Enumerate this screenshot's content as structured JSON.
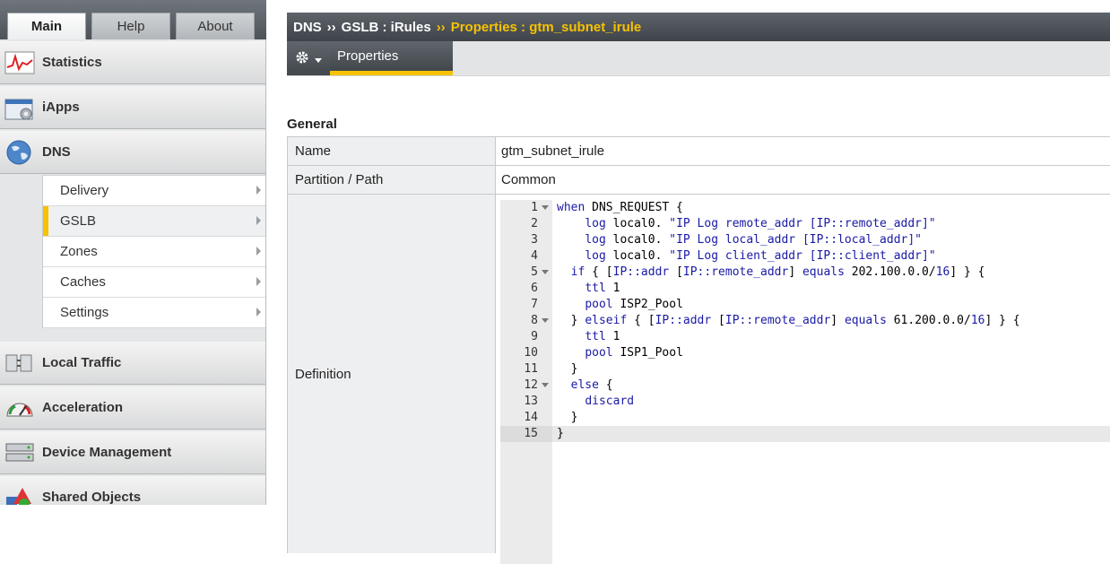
{
  "top_tabs": [
    {
      "label": "Main",
      "active": true
    },
    {
      "label": "Help",
      "active": false
    },
    {
      "label": "About",
      "active": false
    }
  ],
  "nav": {
    "sections": [
      {
        "label": "Statistics",
        "icon": "statistics-chart-icon"
      },
      {
        "label": "iApps",
        "icon": "iapps-gear-icon"
      },
      {
        "label": "DNS",
        "icon": "globe-icon"
      },
      {
        "label": "Local Traffic",
        "icon": "local-traffic-icon"
      },
      {
        "label": "Acceleration",
        "icon": "speedometer-icon"
      },
      {
        "label": "Device Management",
        "icon": "server-icon"
      },
      {
        "label": "Shared Objects",
        "icon": "shapes-icon"
      }
    ],
    "dns_items": [
      {
        "label": "Delivery"
      },
      {
        "label": "GSLB",
        "selected": true
      },
      {
        "label": "Zones"
      },
      {
        "label": "Caches"
      },
      {
        "label": "Settings"
      }
    ]
  },
  "breadcrumb": {
    "part1": "DNS",
    "sep": "››",
    "part2": "GSLB : iRules",
    "current": "Properties : gtm_subnet_irule"
  },
  "toolbar": {
    "gear_icon": "gear-icon",
    "tab_label": "Properties"
  },
  "section_title": "General",
  "properties": {
    "name_label": "Name",
    "name_value": "gtm_subnet_irule",
    "partition_label": "Partition / Path",
    "partition_value": "Common",
    "definition_label": "Definition"
  },
  "code": {
    "lines": [
      "when DNS_REQUEST {",
      "    log local0. \"IP Log remote_addr [IP::remote_addr]\"",
      "    log local0. \"IP Log local_addr [IP::local_addr]\"",
      "    log local0. \"IP Log client_addr [IP::client_addr]\"",
      "  if { [IP::addr [IP::remote_addr] equals 202.100.0.0/16] } {",
      "    ttl 1",
      "    pool ISP2_Pool",
      "  } elseif { [IP::addr [IP::remote_addr] equals 61.200.0.0/16] } {",
      "    ttl 1",
      "    pool ISP1_Pool",
      "  }",
      "  else {",
      "    discard",
      "  }",
      "}"
    ],
    "fold_lines": [
      1,
      5,
      8,
      12
    ],
    "current_line": 15
  }
}
